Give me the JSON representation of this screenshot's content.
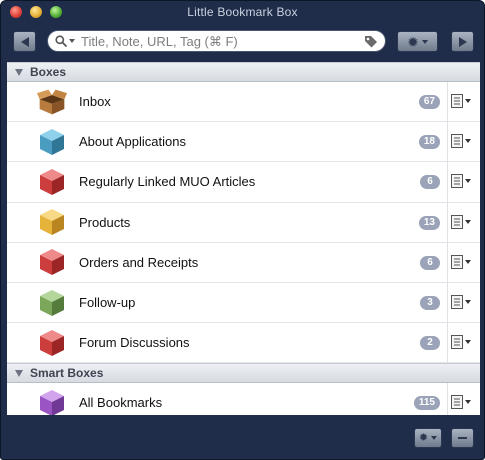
{
  "window": {
    "title": "Little Bookmark Box"
  },
  "toolbar": {
    "back_icon": "back-arrow-icon",
    "forward_icon": "forward-arrow-icon",
    "gear_icon": "gear-icon",
    "search": {
      "placeholder": "Title, Note, URL, Tag (⌘ F)",
      "value": ""
    }
  },
  "groups": [
    {
      "label": "Boxes",
      "items": [
        {
          "label": "Inbox",
          "count": "67",
          "icon": "open-cardboard-box-icon",
          "color": "#b77a3a"
        },
        {
          "label": "About Applications",
          "count": "18",
          "icon": "blue-cube-icon",
          "color": "#4a9cc1"
        },
        {
          "label": "Regularly Linked MUO Articles",
          "count": "6",
          "icon": "red-cube-icon",
          "color": "#cc3d3d"
        },
        {
          "label": "Products",
          "count": "13",
          "icon": "yellow-cube-icon",
          "color": "#e5b23a"
        },
        {
          "label": "Orders and Receipts",
          "count": "6",
          "icon": "red-cube-icon",
          "color": "#cc3d3d"
        },
        {
          "label": "Follow-up",
          "count": "3",
          "icon": "green-cube-icon",
          "color": "#7aa75a"
        },
        {
          "label": "Forum Discussions",
          "count": "2",
          "icon": "red-cube-icon",
          "color": "#cc3d3d"
        }
      ]
    },
    {
      "label": "Smart Boxes",
      "items": [
        {
          "label": "All Bookmarks",
          "count": "115",
          "icon": "purple-cube-icon",
          "color": "#9b54c4"
        }
      ]
    }
  ],
  "bottombar": {
    "add_icon": "add-box-gear-icon",
    "remove_icon": "minus-icon"
  }
}
